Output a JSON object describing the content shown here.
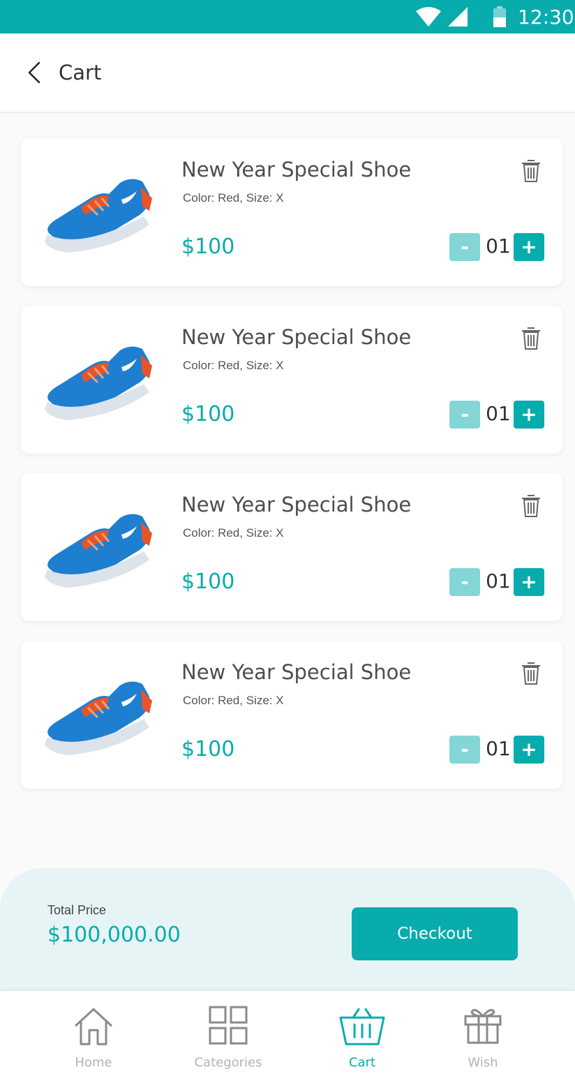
{
  "status_bar": {
    "time": "12:30"
  },
  "header": {
    "title": "Cart"
  },
  "cart_items": [
    {
      "name": "New Year Special Shoe",
      "variant": "Color: Red, Size: X",
      "price": "$100",
      "quantity": "01"
    },
    {
      "name": "New Year Special Shoe",
      "variant": "Color: Red, Size: X",
      "price": "$100",
      "quantity": "01"
    },
    {
      "name": "New Year Special Shoe",
      "variant": "Color: Red, Size: X",
      "price": "$100",
      "quantity": "01"
    },
    {
      "name": "New Year Special Shoe",
      "variant": "Color: Red, Size: X",
      "price": "$100",
      "quantity": "01"
    }
  ],
  "quantity_controls": {
    "minus_label": "-",
    "plus_label": "+"
  },
  "summary": {
    "total_label": "Total Price",
    "total_value": "$100,000.00",
    "checkout_label": "Checkout"
  },
  "bottom_nav": [
    {
      "label": "Home",
      "icon": "home-icon",
      "active": false
    },
    {
      "label": "Categories",
      "icon": "grid-icon",
      "active": false
    },
    {
      "label": "Cart",
      "icon": "basket-icon",
      "active": true
    },
    {
      "label": "Wish",
      "icon": "gift-icon",
      "active": false
    }
  ],
  "colors": {
    "accent": "#08acad",
    "accent_light": "#84d6d6",
    "panel": "#e6f4f5",
    "inactive": "#b3b3b3"
  }
}
